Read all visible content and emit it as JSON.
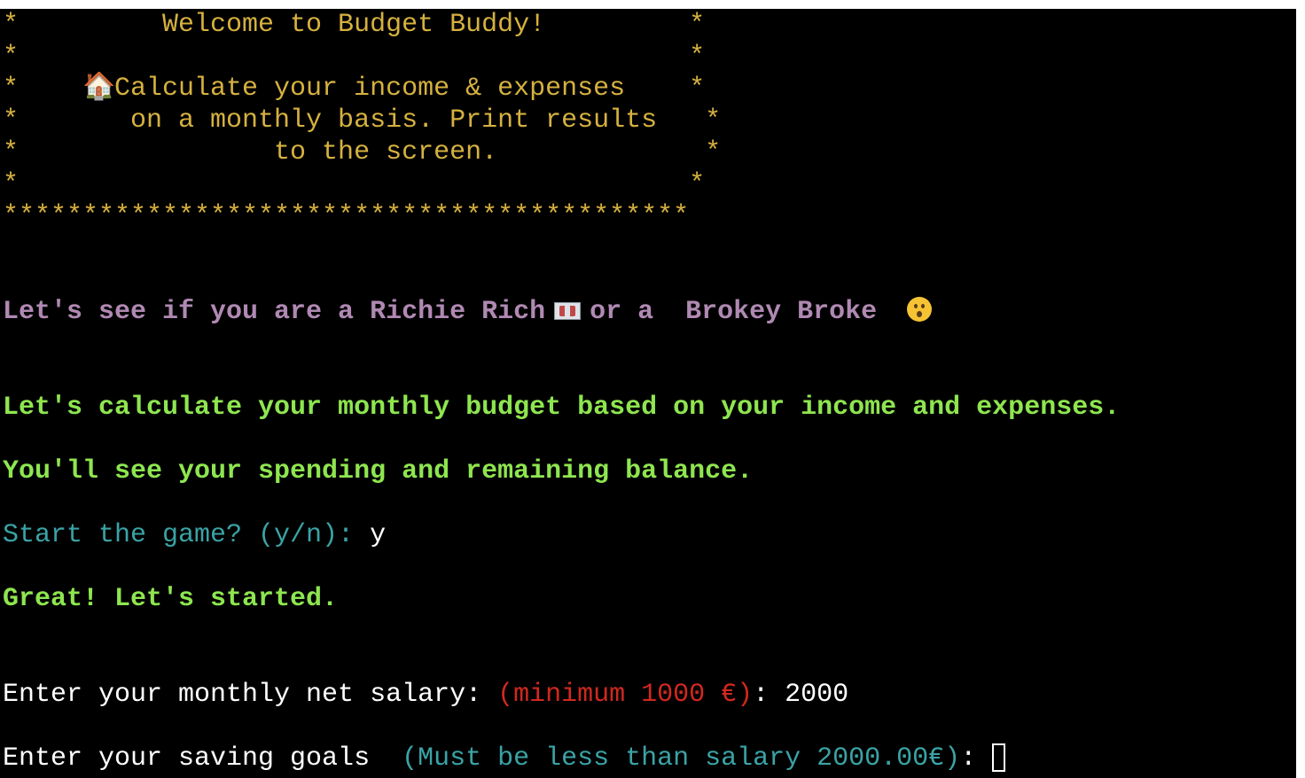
{
  "banner": {
    "line1": "*         Welcome to Budget Buddy!         *",
    "line2": "*                                          *",
    "line3_left": "*    ",
    "line3_icon": "🏠",
    "line3_right": "Calculate your income & expenses    *",
    "line4": "*       on a monthly basis. Print results   *",
    "line5": "*                to the screen.             *",
    "line6": "*                                          *",
    "line7": "*******************************************"
  },
  "tagline": {
    "part1": "Let's see if you are a Richie Rich",
    "part2": "or a  Brokey Broke"
  },
  "intro": {
    "line1": "Let's calculate your monthly budget based on your income and expenses.",
    "line2": "You'll see your spending and remaining balance."
  },
  "start_prompt": {
    "label": "Start the game? (y/n): ",
    "value": "y"
  },
  "start_reply": "Great! Let's started.",
  "salary_prompt": {
    "label": "Enter your monthly net salary: ",
    "hint": "(minimum 1000 €)",
    "suffix": ": ",
    "value": "2000"
  },
  "saving_prompt": {
    "label": "Enter your saving goals  ",
    "hint": "(Must be less than salary 2000.00€)",
    "suffix": ":"
  },
  "icons": {
    "house": "house-icon",
    "ticket": "ticket-icon",
    "face": "astonished-face-icon"
  },
  "colors": {
    "background": "#000000",
    "banner": "#d6b13f",
    "tagline": "#b089b3",
    "success": "#8ee64f",
    "prompt": "#3aa3a6",
    "warning": "#d1281f",
    "input": "#ffffff"
  }
}
